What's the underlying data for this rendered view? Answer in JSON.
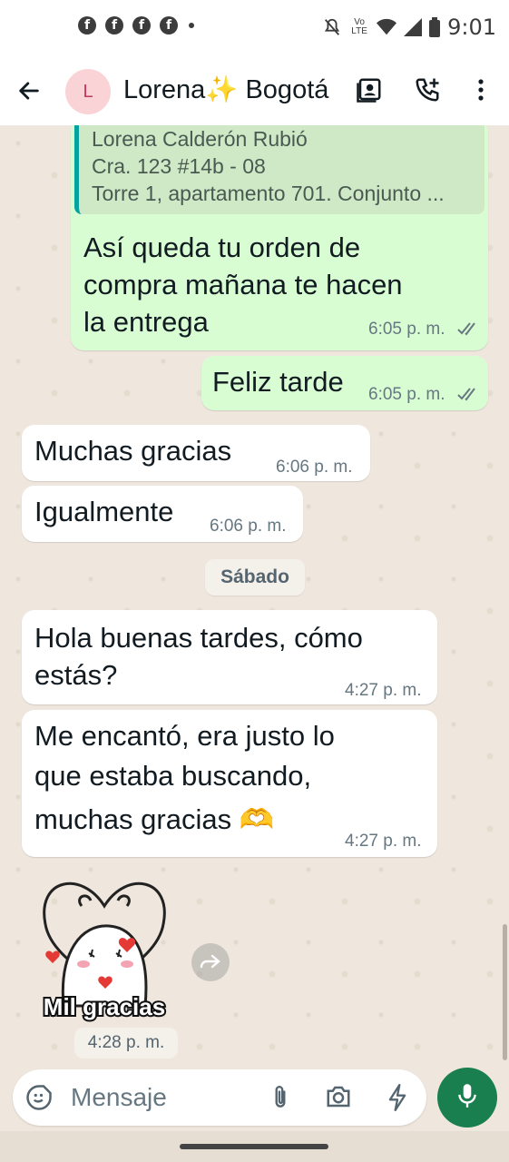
{
  "status_bar": {
    "time": "9:01",
    "notification_icons": [
      "facebook-icon",
      "facebook-icon",
      "facebook-icon",
      "facebook-icon"
    ],
    "network_label": "Vo LTE"
  },
  "header": {
    "avatar_letter": "L",
    "contact_name": "Lorena✨ Bogotá"
  },
  "messages": [
    {
      "direction": "out",
      "quote": [
        "Lorena Calderón Rubió",
        "Cra. 123 #14b - 08",
        "Torre 1, apartamento 701. Conjunto ..."
      ],
      "lines": [
        "Así queda tu orden de",
        "compra mañana te hacen",
        "la entrega"
      ],
      "time": "6:05 p. m.",
      "read": true
    },
    {
      "direction": "out",
      "lines": [
        "Feliz tarde"
      ],
      "time": "6:05 p. m.",
      "read": true
    },
    {
      "direction": "in",
      "lines": [
        "Muchas gracias"
      ],
      "time": "6:06 p. m."
    },
    {
      "direction": "in",
      "lines": [
        "Igualmente"
      ],
      "time": "6:06 p. m."
    },
    {
      "direction": "in",
      "lines": [
        "Hola buenas tardes, cómo",
        "estás?"
      ],
      "time": "4:27 p. m."
    },
    {
      "direction": "in",
      "lines": [
        "Me encantó, era justo lo",
        "que estaba buscando,",
        "muchas gracias 🫶"
      ],
      "time": "4:27 p. m."
    }
  ],
  "date_divider": "Sábado",
  "sticker": {
    "caption": "Mil gracias",
    "time": "4:28 p. m."
  },
  "input": {
    "placeholder": "Mensaje"
  },
  "colors": {
    "outgoing_bubble": "#d9fdd3",
    "incoming_bubble": "#ffffff",
    "accent_green": "#1a7f4e",
    "chat_background": "#efe7dd"
  }
}
